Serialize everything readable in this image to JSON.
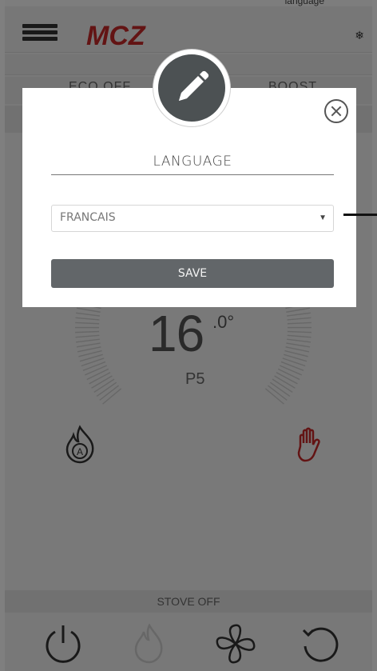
{
  "app": {
    "top_status": "language",
    "logo": "MCZ",
    "mode_left": "ECO OFF",
    "mode_right": "BOOST",
    "temperature": {
      "integer": "16",
      "decimal": ".0°",
      "power_level": "P5"
    },
    "status": "STOVE OFF",
    "bottom_icons": [
      "power-icon",
      "flame-icon",
      "fan-icon",
      "refresh-icon"
    ],
    "accent_color": "#c62828"
  },
  "modal": {
    "title": "LANGUAGE",
    "selected_language": "FRANCAIS",
    "save_label": "SAVE",
    "header_icon": "pencil-icon",
    "close_icon": "close-icon"
  }
}
